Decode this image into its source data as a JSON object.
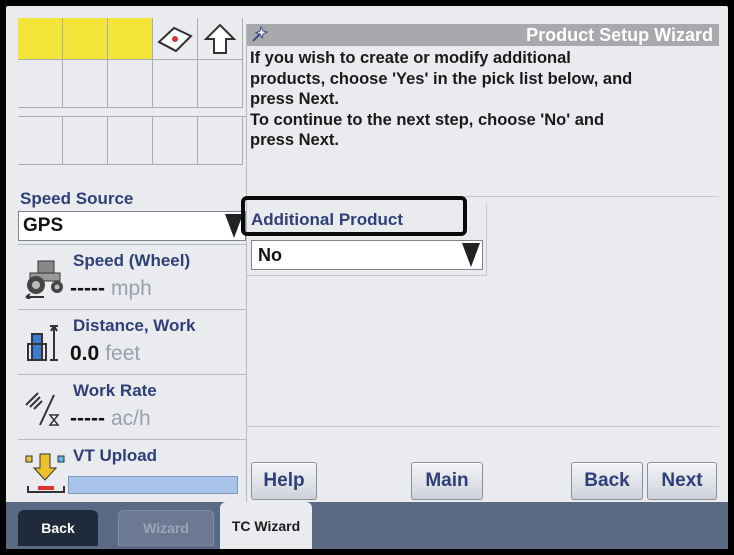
{
  "left_panel": {
    "speed_source": {
      "label": "Speed Source",
      "value": "GPS"
    },
    "speed": {
      "title": "Speed (Wheel)",
      "value": "-----",
      "unit": "mph",
      "icon": "tractor-icon"
    },
    "distance": {
      "title": "Distance, Work",
      "value": "0.0",
      "unit": "feet",
      "icon": "distance-icon"
    },
    "work_rate": {
      "title": "Work Rate",
      "value": "-----",
      "unit": "ac/h",
      "icon": "work-rate-icon"
    },
    "vt_upload": {
      "title": "VT Upload",
      "icon": "upload-icon",
      "progress": 1.0
    }
  },
  "wizard": {
    "title": "Product Setup Wizard",
    "instructions": [
      "If you wish to create or modify additional",
      "products, choose 'Yes' in the pick list below, and",
      "press Next.",
      "To continue to the next step, choose 'No' and",
      "press Next."
    ],
    "additional_product": {
      "label": "Additional Product",
      "value": "No"
    },
    "buttons": {
      "help": "Help",
      "main": "Main",
      "back": "Back",
      "next": "Next"
    }
  },
  "tabs": {
    "back": "Back",
    "wizard": "Wizard",
    "tc_wizard": "TC Wizard"
  },
  "colors": {
    "yellow": "#f4e53a",
    "label_blue": "#2f3f7a",
    "tab_bar": "#5a6a84"
  }
}
